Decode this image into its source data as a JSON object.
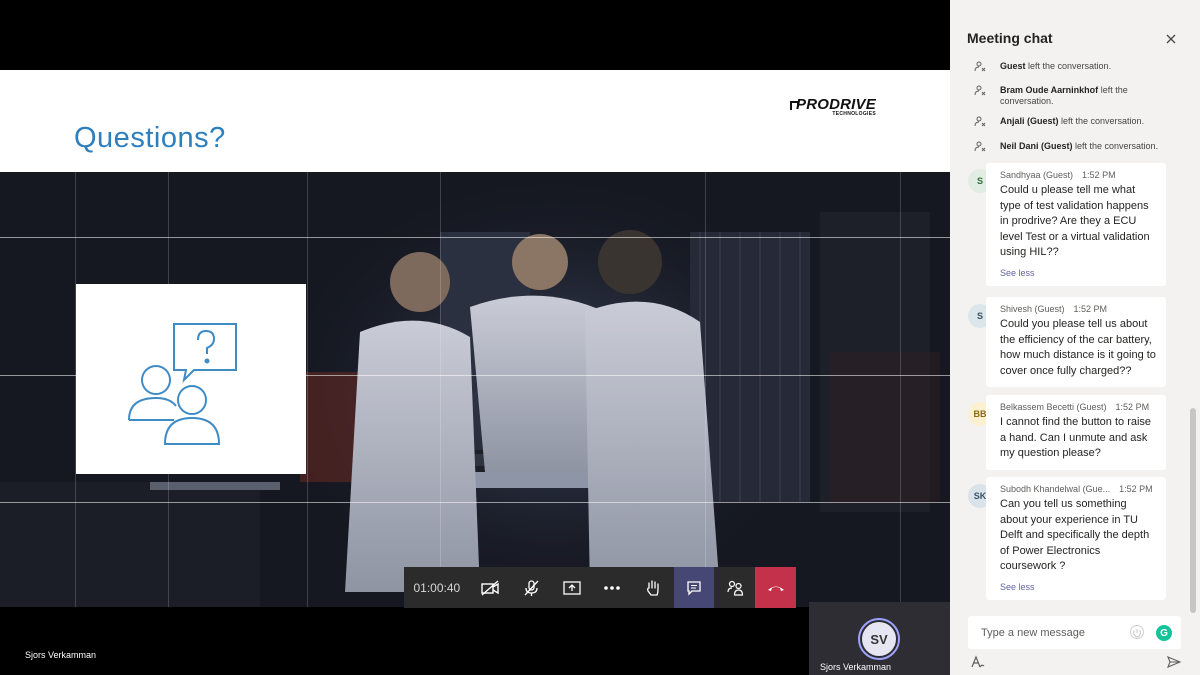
{
  "slide": {
    "title": "Questions?",
    "logo_main": "PRODRIVE",
    "logo_sub": "TECHNOLOGIES"
  },
  "call": {
    "timer": "01:00:40",
    "presenter_name": "Sjors Verkamman",
    "self_initials": "SV",
    "self_name": "Sjors Verkamman"
  },
  "chat": {
    "title": "Meeting chat",
    "system_messages": [
      {
        "name": "Guest",
        "text": " left the conversation."
      },
      {
        "name": "Bram Oude Aarninkhof",
        "text": " left the conversation."
      },
      {
        "name": "Anjali (Guest)",
        "text": " left the conversation."
      },
      {
        "name": "Neil Dani (Guest)",
        "text": " left the conversation."
      }
    ],
    "messages": [
      {
        "initials": "S",
        "sender": "Sandhyaa (Guest)",
        "time": "1:52 PM",
        "body": "Could u please tell me what type of test validation happens in prodrive? Are they a ECU level Test or a virtual validation using HIL??",
        "see_less": "See less",
        "avatar_color": "#e1ede3",
        "avatar_text": "#2f6b3a"
      },
      {
        "initials": "S",
        "sender": "Shivesh (Guest)",
        "time": "1:52 PM",
        "body": "Could you please tell us about the efficiency of the car battery, how much distance is it going to cover once fully charged??",
        "see_less": "",
        "avatar_color": "#dbe6ea",
        "avatar_text": "#36525e"
      },
      {
        "initials": "BB",
        "sender": "Belkassem Becetti (Guest)",
        "time": "1:52 PM",
        "body": "I cannot find the button to raise a hand. Can I unmute and ask my question please?",
        "see_less": "",
        "avatar_color": "#fbf0cf",
        "avatar_text": "#8a6a13"
      },
      {
        "initials": "SK",
        "sender": "Subodh Khandelwal (Gue...",
        "time": "1:52 PM",
        "body": "Can you tell us something about your experience in TU Delft and specifically the depth of Power Electronics coursework ?",
        "see_less": "See less",
        "avatar_color": "#dbe3ea",
        "avatar_text": "#3c5366"
      }
    ],
    "compose_placeholder": "Type a new message"
  },
  "colors": {
    "accent": "#6264a7",
    "hangup": "#c4314b",
    "slide_title": "#2e7fbd"
  }
}
